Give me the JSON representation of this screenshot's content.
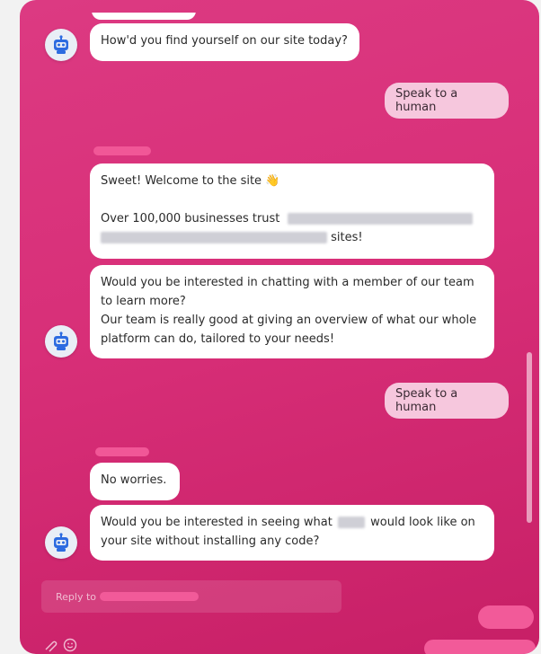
{
  "messages": {
    "q_find": "How'd you find yourself on our site today?",
    "human_1": "Speak to a human",
    "welcome_1": "Sweet! Welcome to the site 👋",
    "welcome_2": "Over 100,000 businesses trust",
    "welcome_3": "sites!",
    "interest_1": "Would you be interested in chatting with a member of our team",
    "interest_2": "to learn more?",
    "interest_3": "Our team is really good at giving an overview of what our whole",
    "interest_4": "platform can do, tailored to your needs!",
    "human_2": "Speak to a human",
    "no_worries": "No worries.",
    "see_1": "Would you be interested in seeing what",
    "see_2": "would look like on",
    "see_3": "your site without installing any code?"
  },
  "composer": {
    "placeholder": "Reply to"
  },
  "colors": {
    "panel": "#d82f78",
    "human_bubble": "#f6c7dd",
    "bot_bubble": "#ffffff",
    "accent": "#f25a99"
  },
  "icons": [
    "bot-avatar-icon",
    "attachment-icon",
    "emoji-icon"
  ]
}
